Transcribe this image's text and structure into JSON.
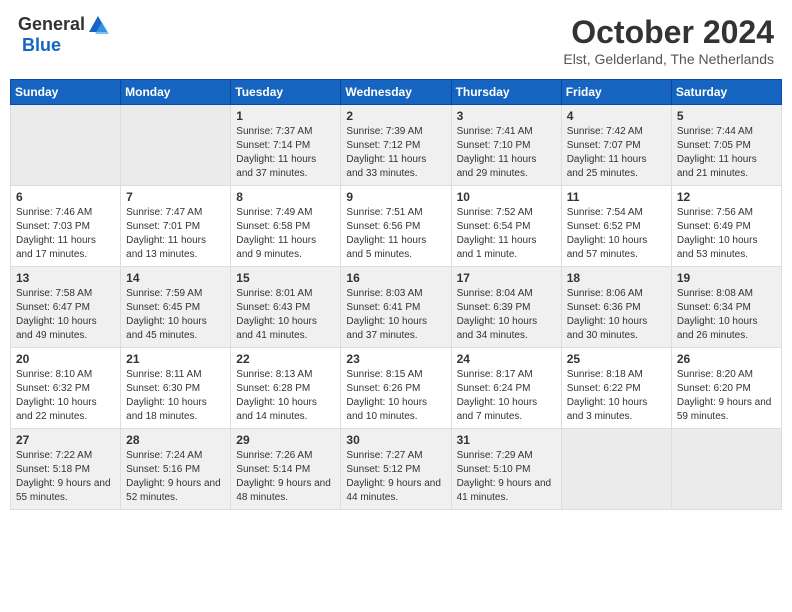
{
  "header": {
    "logo_general": "General",
    "logo_blue": "Blue",
    "month_title": "October 2024",
    "subtitle": "Elst, Gelderland, The Netherlands"
  },
  "weekdays": [
    "Sunday",
    "Monday",
    "Tuesday",
    "Wednesday",
    "Thursday",
    "Friday",
    "Saturday"
  ],
  "weeks": [
    [
      {
        "day": "",
        "info": ""
      },
      {
        "day": "",
        "info": ""
      },
      {
        "day": "1",
        "info": "Sunrise: 7:37 AM\nSunset: 7:14 PM\nDaylight: 11 hours and 37 minutes."
      },
      {
        "day": "2",
        "info": "Sunrise: 7:39 AM\nSunset: 7:12 PM\nDaylight: 11 hours and 33 minutes."
      },
      {
        "day": "3",
        "info": "Sunrise: 7:41 AM\nSunset: 7:10 PM\nDaylight: 11 hours and 29 minutes."
      },
      {
        "day": "4",
        "info": "Sunrise: 7:42 AM\nSunset: 7:07 PM\nDaylight: 11 hours and 25 minutes."
      },
      {
        "day": "5",
        "info": "Sunrise: 7:44 AM\nSunset: 7:05 PM\nDaylight: 11 hours and 21 minutes."
      }
    ],
    [
      {
        "day": "6",
        "info": "Sunrise: 7:46 AM\nSunset: 7:03 PM\nDaylight: 11 hours and 17 minutes."
      },
      {
        "day": "7",
        "info": "Sunrise: 7:47 AM\nSunset: 7:01 PM\nDaylight: 11 hours and 13 minutes."
      },
      {
        "day": "8",
        "info": "Sunrise: 7:49 AM\nSunset: 6:58 PM\nDaylight: 11 hours and 9 minutes."
      },
      {
        "day": "9",
        "info": "Sunrise: 7:51 AM\nSunset: 6:56 PM\nDaylight: 11 hours and 5 minutes."
      },
      {
        "day": "10",
        "info": "Sunrise: 7:52 AM\nSunset: 6:54 PM\nDaylight: 11 hours and 1 minute."
      },
      {
        "day": "11",
        "info": "Sunrise: 7:54 AM\nSunset: 6:52 PM\nDaylight: 10 hours and 57 minutes."
      },
      {
        "day": "12",
        "info": "Sunrise: 7:56 AM\nSunset: 6:49 PM\nDaylight: 10 hours and 53 minutes."
      }
    ],
    [
      {
        "day": "13",
        "info": "Sunrise: 7:58 AM\nSunset: 6:47 PM\nDaylight: 10 hours and 49 minutes."
      },
      {
        "day": "14",
        "info": "Sunrise: 7:59 AM\nSunset: 6:45 PM\nDaylight: 10 hours and 45 minutes."
      },
      {
        "day": "15",
        "info": "Sunrise: 8:01 AM\nSunset: 6:43 PM\nDaylight: 10 hours and 41 minutes."
      },
      {
        "day": "16",
        "info": "Sunrise: 8:03 AM\nSunset: 6:41 PM\nDaylight: 10 hours and 37 minutes."
      },
      {
        "day": "17",
        "info": "Sunrise: 8:04 AM\nSunset: 6:39 PM\nDaylight: 10 hours and 34 minutes."
      },
      {
        "day": "18",
        "info": "Sunrise: 8:06 AM\nSunset: 6:36 PM\nDaylight: 10 hours and 30 minutes."
      },
      {
        "day": "19",
        "info": "Sunrise: 8:08 AM\nSunset: 6:34 PM\nDaylight: 10 hours and 26 minutes."
      }
    ],
    [
      {
        "day": "20",
        "info": "Sunrise: 8:10 AM\nSunset: 6:32 PM\nDaylight: 10 hours and 22 minutes."
      },
      {
        "day": "21",
        "info": "Sunrise: 8:11 AM\nSunset: 6:30 PM\nDaylight: 10 hours and 18 minutes."
      },
      {
        "day": "22",
        "info": "Sunrise: 8:13 AM\nSunset: 6:28 PM\nDaylight: 10 hours and 14 minutes."
      },
      {
        "day": "23",
        "info": "Sunrise: 8:15 AM\nSunset: 6:26 PM\nDaylight: 10 hours and 10 minutes."
      },
      {
        "day": "24",
        "info": "Sunrise: 8:17 AM\nSunset: 6:24 PM\nDaylight: 10 hours and 7 minutes."
      },
      {
        "day": "25",
        "info": "Sunrise: 8:18 AM\nSunset: 6:22 PM\nDaylight: 10 hours and 3 minutes."
      },
      {
        "day": "26",
        "info": "Sunrise: 8:20 AM\nSunset: 6:20 PM\nDaylight: 9 hours and 59 minutes."
      }
    ],
    [
      {
        "day": "27",
        "info": "Sunrise: 7:22 AM\nSunset: 5:18 PM\nDaylight: 9 hours and 55 minutes."
      },
      {
        "day": "28",
        "info": "Sunrise: 7:24 AM\nSunset: 5:16 PM\nDaylight: 9 hours and 52 minutes."
      },
      {
        "day": "29",
        "info": "Sunrise: 7:26 AM\nSunset: 5:14 PM\nDaylight: 9 hours and 48 minutes."
      },
      {
        "day": "30",
        "info": "Sunrise: 7:27 AM\nSunset: 5:12 PM\nDaylight: 9 hours and 44 minutes."
      },
      {
        "day": "31",
        "info": "Sunrise: 7:29 AM\nSunset: 5:10 PM\nDaylight: 9 hours and 41 minutes."
      },
      {
        "day": "",
        "info": ""
      },
      {
        "day": "",
        "info": ""
      }
    ]
  ]
}
